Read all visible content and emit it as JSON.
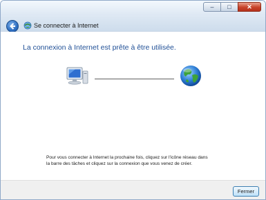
{
  "window": {
    "title": "Se connecter à Internet",
    "caption_buttons": {
      "minimize_glyph": "‒",
      "maximize_glyph": "□",
      "close_glyph": "✕"
    }
  },
  "main": {
    "heading": "La connexion à Internet est prête à être utilisée.",
    "diagram": {
      "left_icon": "computer-icon",
      "right_icon": "globe-icon"
    },
    "note": "Pour vous connecter à Internet la prochaine fois, cliquez sur l'icône réseau dans la barre des tâches et cliquez sur la connexion que vous venez de créer."
  },
  "footer": {
    "close_label": "Fermer"
  },
  "colors": {
    "heading": "#1e4e95",
    "accent": "#3c7fb1"
  }
}
